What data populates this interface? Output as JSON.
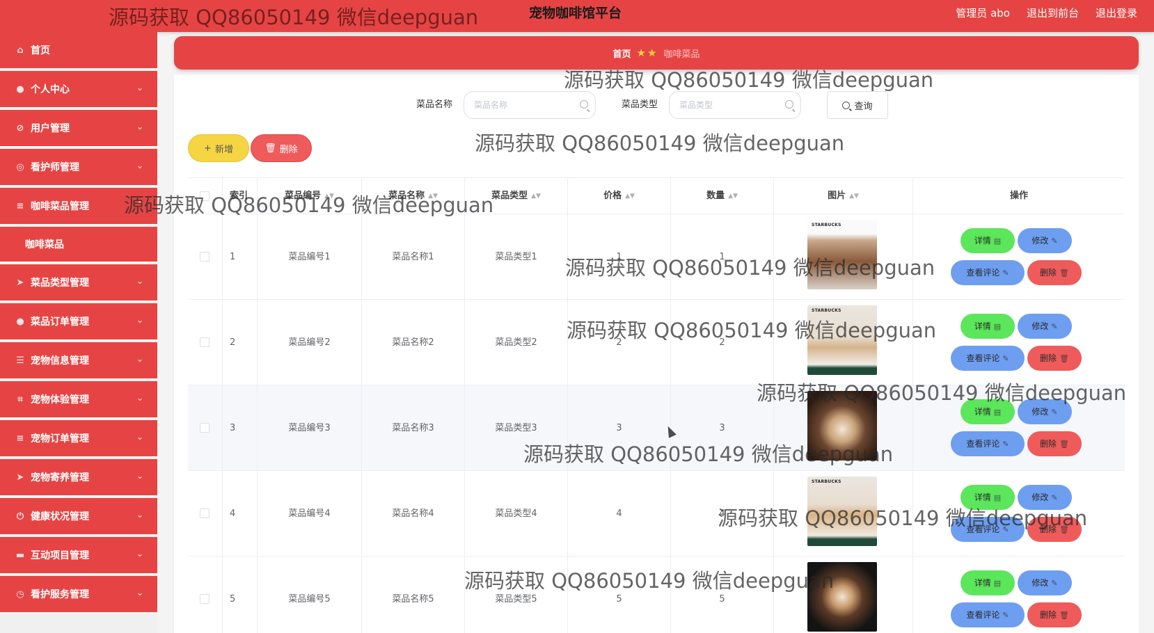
{
  "header": {
    "title": "宠物咖啡馆平台",
    "admin": "管理员 abo",
    "back_front": "退出到前台",
    "logout": "退出登录"
  },
  "sidebar": {
    "items": [
      {
        "label": "首页",
        "icon": "home-icon"
      },
      {
        "label": "个人中心",
        "icon": "user-icon"
      },
      {
        "label": "用户管理",
        "icon": "users-icon"
      },
      {
        "label": "看护师管理",
        "icon": "nurse-icon"
      },
      {
        "label": "咖啡菜品管理",
        "icon": "list-icon"
      },
      {
        "label": "咖啡菜品",
        "icon": ""
      },
      {
        "label": "菜品类型管理",
        "icon": "send-icon"
      },
      {
        "label": "菜品订单管理",
        "icon": "user-icon"
      },
      {
        "label": "宠物信息管理",
        "icon": "sliders-icon"
      },
      {
        "label": "宠物体验管理",
        "icon": "crop-icon"
      },
      {
        "label": "宠物订单管理",
        "icon": "list-icon"
      },
      {
        "label": "宠物寄养管理",
        "icon": "send-icon"
      },
      {
        "label": "健康状况管理",
        "icon": "power-icon"
      },
      {
        "label": "互动项目管理",
        "icon": "book-icon"
      },
      {
        "label": "看护服务管理",
        "icon": "service-icon"
      }
    ]
  },
  "breadcrumb": {
    "home": "首页",
    "current": "咖啡菜品"
  },
  "search": {
    "name_label": "菜品名称",
    "name_placeholder": "菜品名称",
    "type_label": "菜品类型",
    "type_placeholder": "菜品类型",
    "query_label": "查询"
  },
  "actions": {
    "add_label": "新增",
    "delete_label": "删除"
  },
  "table": {
    "headers": [
      "索引",
      "菜品编号",
      "菜品名称",
      "菜品类型",
      "价格",
      "数量",
      "图片",
      "操作"
    ],
    "rows": [
      {
        "index": "1",
        "code": "菜品编号1",
        "name": "菜品名称1",
        "type": "菜品类型1",
        "price": "1",
        "qty": "1"
      },
      {
        "index": "2",
        "code": "菜品编号2",
        "name": "菜品名称2",
        "type": "菜品类型2",
        "price": "2",
        "qty": "2"
      },
      {
        "index": "3",
        "code": "菜品编号3",
        "name": "菜品名称3",
        "type": "菜品类型3",
        "price": "3",
        "qty": "3"
      },
      {
        "index": "4",
        "code": "菜品编号4",
        "name": "菜品名称4",
        "type": "菜品类型4",
        "price": "4",
        "qty": "4"
      },
      {
        "index": "5",
        "code": "菜品编号5",
        "name": "菜品名称5",
        "type": "菜品类型5",
        "price": "5",
        "qty": "5"
      }
    ],
    "op_labels": {
      "detail": "详情",
      "edit": "修改",
      "comment": "查看评论",
      "delete": "删除"
    },
    "image_brand": "STARBUCKS"
  },
  "watermark": "源码获取 QQ86050149 微信deepguan",
  "colors": {
    "primary_red": "#e64444",
    "add_yellow": "#f6d542",
    "detail_green": "#5be65b",
    "edit_blue": "#6d9ef0",
    "delete_red": "#ef5b5b"
  }
}
